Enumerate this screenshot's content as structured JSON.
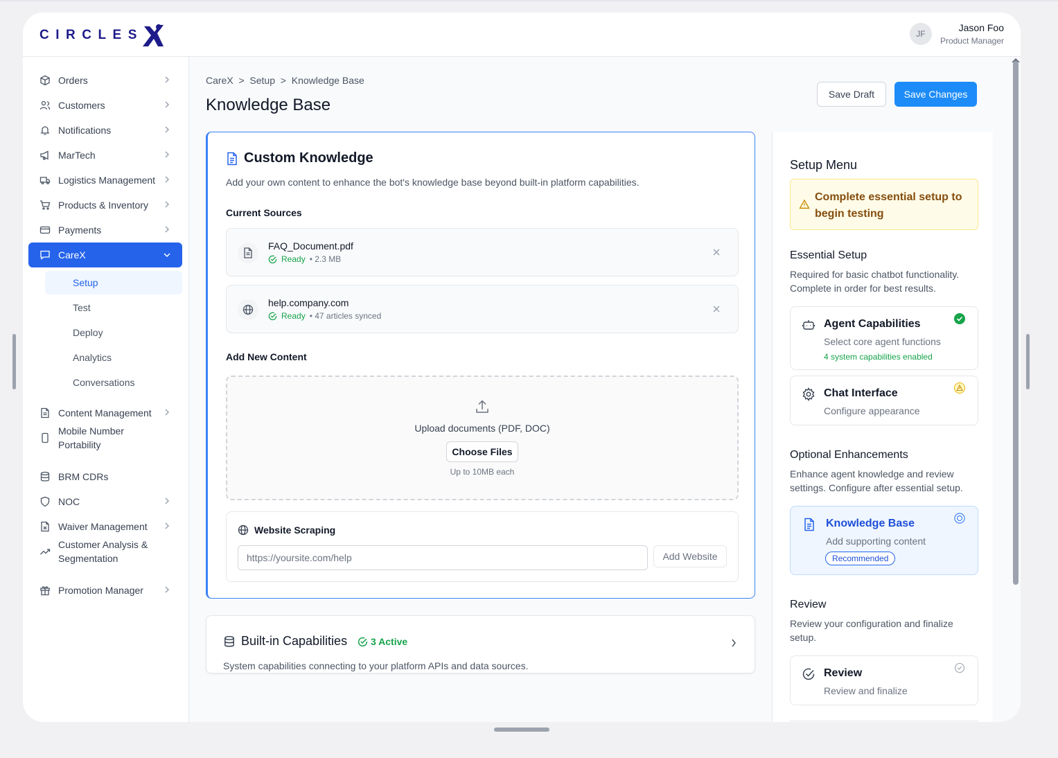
{
  "app": {
    "logo_text": "CIRCLES",
    "brand_color": "#1e1b8a",
    "accent_color": "#2563eb"
  },
  "user": {
    "initials": "JF",
    "name": "Jason Foo",
    "role": "Product Manager"
  },
  "sidebar": {
    "items": [
      {
        "label": "Orders",
        "icon": "box-icon"
      },
      {
        "label": "Customers",
        "icon": "users-icon"
      },
      {
        "label": "Notifications",
        "icon": "bell-icon"
      },
      {
        "label": "MarTech",
        "icon": "megaphone-icon"
      },
      {
        "label": "Logistics Management",
        "icon": "truck-icon"
      },
      {
        "label": "Products & Inventory",
        "icon": "cart-icon"
      },
      {
        "label": "Payments",
        "icon": "credit-card-icon"
      },
      {
        "label": "CareX",
        "icon": "chat-icon"
      },
      {
        "label": "Content Management",
        "icon": "file-icon"
      },
      {
        "label": "Mobile Number Portability",
        "icon": "phone-icon"
      },
      {
        "label": "BRM CDRs",
        "icon": "database-icon"
      },
      {
        "label": "NOC",
        "icon": "shield-icon"
      },
      {
        "label": "Waiver Management",
        "icon": "file-x-icon"
      },
      {
        "label": "Customer Analysis & Segmentation",
        "icon": "trend-icon"
      },
      {
        "label": "Promotion Manager",
        "icon": "gift-icon"
      }
    ],
    "carex_sub": [
      "Setup",
      "Test",
      "Deploy",
      "Analytics",
      "Conversations"
    ]
  },
  "breadcrumb": "CareX  >  Setup  >  Knowledge Base",
  "page_title": "Knowledge Base",
  "actions": {
    "save_draft": "Save Draft",
    "save_changes": "Save Changes"
  },
  "custom_knowledge": {
    "title": "Custom Knowledge",
    "description": "Add your own content to enhance the bot's knowledge base beyond built-in platform capabilities.",
    "current_sources_label": "Current Sources",
    "sources": [
      {
        "name": "FAQ_Document.pdf",
        "status": "Ready",
        "meta": "• 2.3 MB",
        "icon": "document-icon"
      },
      {
        "name": "help.company.com",
        "status": "Ready",
        "meta": "• 47 articles synced",
        "icon": "globe-icon"
      }
    ],
    "add_new_label": "Add New Content",
    "upload": {
      "text": "Upload documents (PDF, DOC)",
      "button": "Choose Files",
      "note": "Up to 10MB each"
    },
    "scraping": {
      "title": "Website Scraping",
      "placeholder": "https://yoursite.com/help",
      "button": "Add Website"
    }
  },
  "builtin": {
    "title": "Built-in Capabilities",
    "badge": "3 Active",
    "description": "System capabilities connecting to your platform APIs and data sources."
  },
  "setup_menu": {
    "title": "Setup Menu",
    "warning": "Complete essential setup to begin testing",
    "essential": {
      "title": "Essential Setup",
      "description": "Required for basic chatbot functionality. Complete in order for best results.",
      "steps": [
        {
          "title": "Agent Capabilities",
          "desc": "Select core agent functions",
          "extra": "4 system capabilities enabled",
          "status": "complete"
        },
        {
          "title": "Chat Interface",
          "desc": "Configure appearance",
          "status": "warning"
        }
      ]
    },
    "optional": {
      "title": "Optional Enhancements",
      "description": "Enhance agent knowledge and review settings. Configure after essential setup.",
      "steps": [
        {
          "title": "Knowledge Base",
          "desc": "Add supporting content",
          "badge": "Recommended",
          "status": "current"
        }
      ]
    },
    "review": {
      "title": "Review",
      "description": "Review your configuration and finalize setup.",
      "steps": [
        {
          "title": "Review",
          "desc": "Review and finalize",
          "status": "pending"
        }
      ]
    }
  }
}
